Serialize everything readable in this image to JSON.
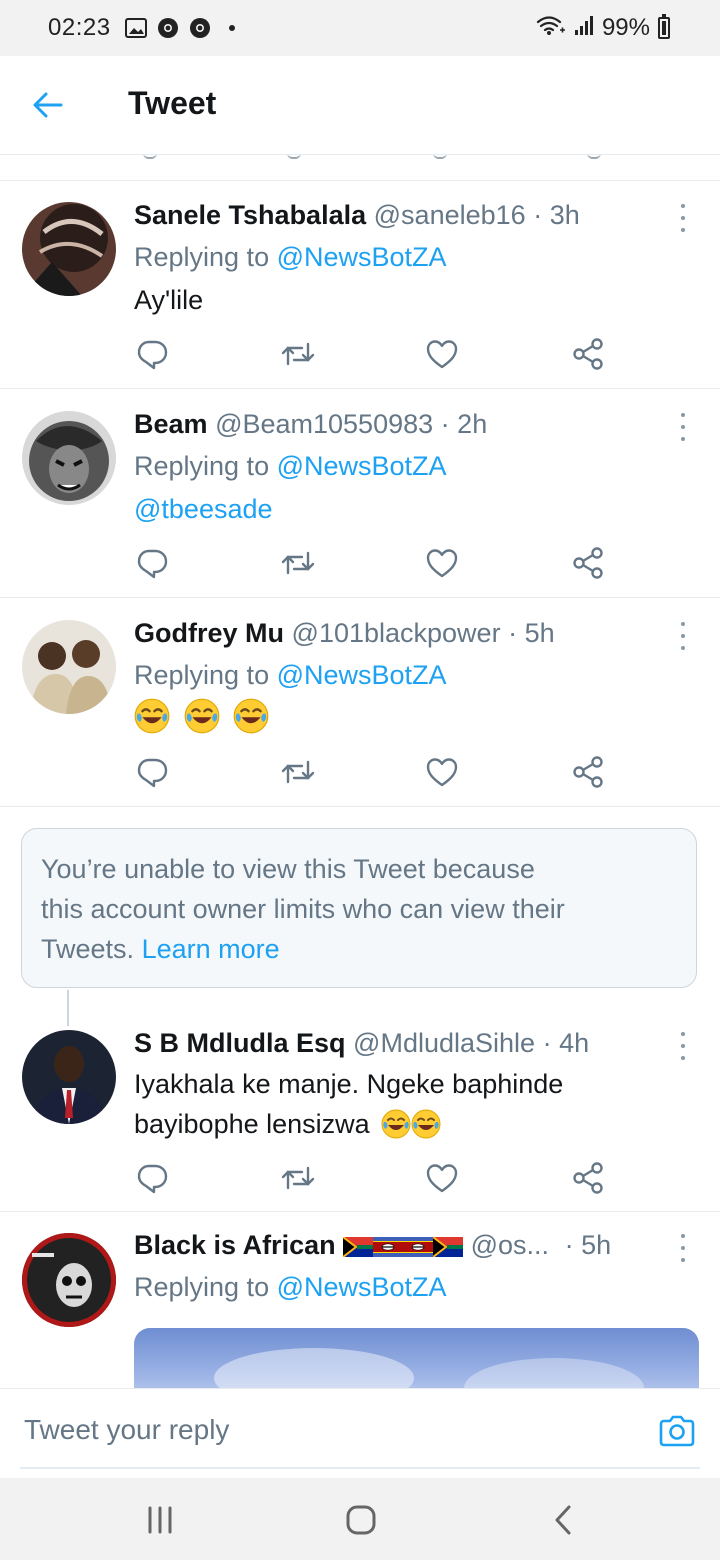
{
  "status_bar": {
    "time": "02:23",
    "notification_icons": [
      "image-icon",
      "chrome-icon",
      "chrome-icon",
      "dot-icon"
    ],
    "battery": "99%"
  },
  "header": {
    "title": "Tweet",
    "back_icon": "arrow-left-icon"
  },
  "tweets": [
    {
      "name": "Sanele Tshabalala",
      "handle": "@saneleb16",
      "sep": "·",
      "time": "3h",
      "replying_label": "Replying to",
      "replying_to": "@NewsBotZA",
      "text": "Ay'lile"
    },
    {
      "name": "Beam",
      "handle": "@Beam10550983",
      "sep": "·",
      "time": "2h",
      "replying_label": "Replying to",
      "replying_to": "@NewsBotZA",
      "text": "@tbeesade"
    },
    {
      "name": "Godfrey Mu",
      "handle": "@101blackpower",
      "sep": "·",
      "time": "5h",
      "replying_label": "Replying to",
      "replying_to": "@NewsBotZA",
      "emojis": [
        "tears-of-joy",
        "tears-of-joy",
        "tears-of-joy"
      ]
    },
    {
      "name": "S B Mdludla Esq",
      "handle": "@MdludlaSihle",
      "sep": "·",
      "time": "4h",
      "text_line1": "Iyakhala ke manje. Ngeke baphinde",
      "text_line2": "bayibophe lensizwa",
      "emojis": [
        "tears-of-joy",
        "tears-of-joy"
      ]
    },
    {
      "name": "Black is African",
      "flags": [
        "south-africa-flag",
        "eswatini-flag",
        "eswatini-flag",
        "south-africa-flag"
      ],
      "handle": "@os...",
      "sep": "·",
      "time": "5h",
      "replying_label": "Replying to",
      "replying_to": "@NewsBotZA"
    }
  ],
  "notice": {
    "line1": "You’re unable to view this Tweet because",
    "line2": "this account owner limits who can view their",
    "line3_prefix": "Tweets.",
    "learn_more": "Learn more"
  },
  "actions": [
    "reply-icon",
    "retweet-icon",
    "like-icon",
    "share-icon"
  ],
  "compose": {
    "placeholder": "Tweet your reply",
    "camera_icon": "camera-icon"
  },
  "nav_bar": [
    "recent-apps-icon",
    "home-icon",
    "back-icon"
  ],
  "colors": {
    "accent": "#1da1f2",
    "secondary_text": "#657786",
    "divider": "#e6ecf0"
  }
}
